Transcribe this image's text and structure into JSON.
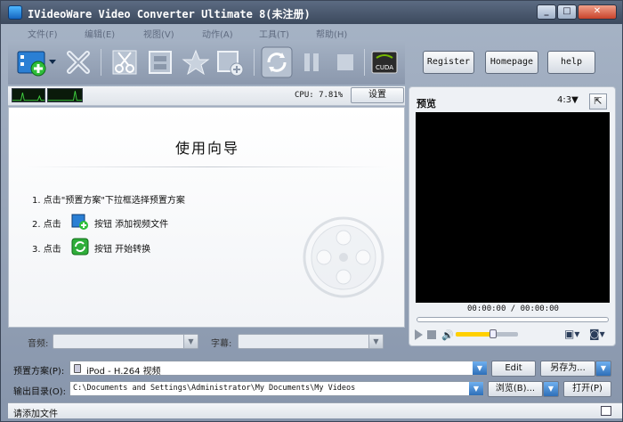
{
  "window": {
    "title": "IVideoWare Video Converter Ultimate 8(未注册)",
    "minimize": "_",
    "maximize": "□",
    "close": "✕"
  },
  "menu": [
    "文件(F)",
    "编辑(E)",
    "视图(V)",
    "动作(A)",
    "工具(T)",
    "帮助(H)"
  ],
  "toolbar": {
    "icons": [
      "add-video-icon",
      "remove-icon",
      "cut-icon",
      "film-edit-icon",
      "effect-star-icon",
      "add-film-icon",
      "convert-icon",
      "pause-icon",
      "stop-icon",
      "cuda-icon"
    ],
    "cuda_label": "CUDA"
  },
  "status": {
    "cpu": "CPU: 7.81%",
    "settings": "设置"
  },
  "guide": {
    "title": "使用向导",
    "step1": "1. 点击\"预置方案\"下拉框选择预置方案",
    "step2_prefix": "2. 点击",
    "step2_suffix": "按钮 添加视频文件",
    "step3_prefix": "3. 点击",
    "step3_suffix": "按钮 开始转换"
  },
  "selectors": {
    "audio_label": "音频:",
    "subtitle_label": "字幕:"
  },
  "side": {
    "register": "Register",
    "homepage": "Homepage",
    "help": "help"
  },
  "preview": {
    "title": "预览",
    "ratio": "4:3▼",
    "timecode": "00:00:00 / 00:00:00",
    "volume": 0.6
  },
  "profile": {
    "label": "预置方案(P):",
    "value": "iPod - H.264 视频",
    "edit": "Edit",
    "save_as": "另存为..."
  },
  "output": {
    "label": "输出目录(O):",
    "path": "C:\\Documents and Settings\\Administrator\\My Documents\\My Videos",
    "browse": "浏览(B)...",
    "open": "打开(P)"
  },
  "statusbar": {
    "text": "请添加文件"
  },
  "colors": {
    "accent": "#2e6fb8",
    "volume_fill": "#ffd000"
  }
}
